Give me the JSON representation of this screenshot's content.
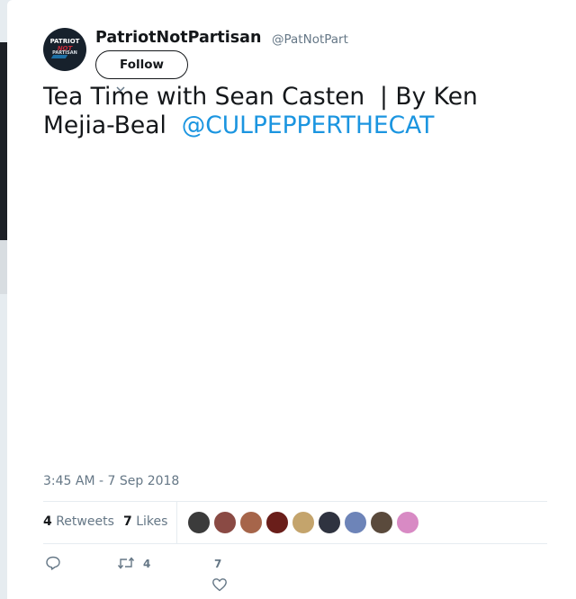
{
  "user": {
    "display_name": "PatriotNotPartisan",
    "handle": "@PatNotPart",
    "avatar_lines": [
      "PATRIOT",
      "NOT",
      "PARTISAN"
    ]
  },
  "follow_label": "Follow",
  "tweet": {
    "text": "Tea Time with Sean Casten  | By Ken Mejia-Beal  ",
    "mention": "@CULPEPPERTHECAT",
    "timestamp": "3:45 AM - 7 Sep 2018"
  },
  "stats": {
    "retweets_count": "4",
    "retweets_label": "Retweets",
    "likes_count": "7",
    "likes_label": "Likes"
  },
  "liker_avatars": [
    {
      "color": "#3b3b3b"
    },
    {
      "color": "#8a4a44"
    },
    {
      "color": "#a6654a"
    },
    {
      "color": "#6a1e1a"
    },
    {
      "color": "#c4a46c"
    },
    {
      "color": "#2f3340"
    },
    {
      "color": "#6d84b8"
    },
    {
      "color": "#5a4a3c"
    },
    {
      "color": "#d88ac4"
    }
  ],
  "actions": {
    "retweet_count": "4",
    "like_count": "7"
  },
  "icons": [
    "reply-icon",
    "retweet-icon",
    "heart-icon",
    "chevron-down-icon"
  ]
}
